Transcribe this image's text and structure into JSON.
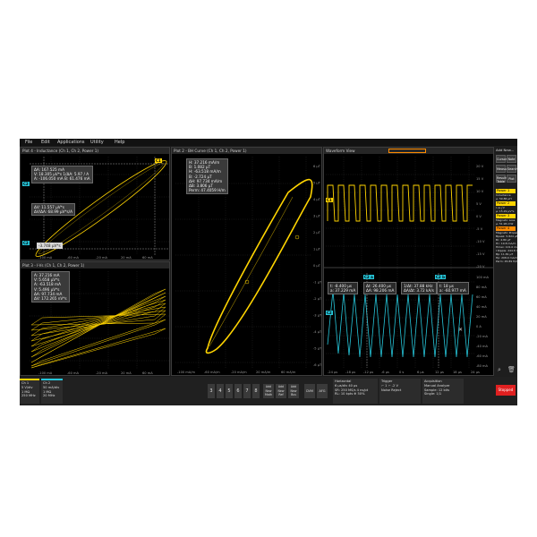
{
  "menu": {
    "items": [
      "File",
      "Edit",
      "Applications",
      "Utility",
      "Help"
    ]
  },
  "plot4": {
    "title": "Plot 4 - Inductance (Ch 1, Ch 2, Power 1)",
    "readout_a": [
      "ΔA: 167.525 mA",
      "V: 18.305 µV*s  1/ΔA: 5.97 / A",
      "A: -106.050 mA   B: 61.476 mA"
    ],
    "readout_b": [
      "ΔV: 11.557 µV*s",
      "ΔV/ΔA: 68.99 µV*s/A"
    ],
    "cursor_value": "-3.748 µV*s",
    "xticks": [
      "-100 mA",
      "-60 mA",
      "-20 mA",
      "20 mA",
      "60 mA",
      "100 mA"
    ]
  },
  "plot3": {
    "title": "Plot 3 - I-Vs (Ch 1, Ch 2, Power 1)",
    "readout": [
      "A: 37.216 mA",
      "V: 5.658 µV*s",
      "A: -63.518 mA",
      "V: 5.496 µV*s",
      "ΔA: 97.734 mA",
      "ΔV: 172.265 nV*s"
    ],
    "xticks": [
      "-100 mA",
      "-60 mA",
      "-20 mA",
      "20 mA",
      "60 mA",
      "100 mA"
    ]
  },
  "plot2": {
    "title": "Plot 2 - BH Curve (Ch 1, Ch 2, Power 1)",
    "readout": [
      "H: 37.216 mA/m",
      "B: 1.082 µT",
      "H: -63.518 mA/m",
      "B: -2.724 µT",
      "ΔH: 97.734 mA/m",
      "ΔB: 3.806 µT",
      "Perm: 47.4059 H/m"
    ],
    "yticks": [
      "6 µT",
      "5 µT",
      "4 µT",
      "3 µT",
      "2 µT",
      "1 µT",
      "0 µT",
      "-1 µT",
      "-2 µT",
      "-3 µT",
      "-4 µT",
      "-5 µT",
      "-6 µT"
    ],
    "xticks": [
      "-100 mA/m",
      "-60 mA/m",
      "-20 mA/m",
      "20 mA/m",
      "60 mA/m",
      "100 mA/m"
    ]
  },
  "waveform": {
    "title": "Waveform View",
    "top_yticks": [
      "20 V",
      "15 V",
      "10 V",
      "5 V",
      "0 V",
      "-5 V",
      "-10 V",
      "-15 V",
      "-20 V"
    ],
    "bottom_yticks": [
      "100 mA",
      "80 mA",
      "60 mA",
      "40 mA",
      "20 mA",
      "0 A",
      "-20 mA",
      "-40 mA",
      "-60 mA",
      "-80 mA"
    ],
    "readout_left": [
      "t: -8.400 µs",
      "a: 37.229 mA"
    ],
    "readout_mid": [
      "Δt: 26.400 µs",
      "ΔA: 98.206 mA"
    ],
    "readout_mid2": [
      "1/Δt: 37.88 kHz",
      "ΔA/Δt: 3.72 kA/s"
    ],
    "readout_right": [
      "t: 18 µs",
      "a: -60.977 mA"
    ],
    "xticks": [
      "-24 µs",
      "-18 µs",
      "-12 µs",
      "-6 µs",
      "0 s",
      "6 µs",
      "12 µs",
      "18 µs",
      "24 µs"
    ]
  },
  "rightpanel": {
    "add_new": "Add New...",
    "buttons": [
      "Cursors",
      "Note",
      "Measure",
      "Search",
      "Results Table",
      "Plot"
    ],
    "power1": {
      "label": "Power 1",
      "lines": [
        "Inductance",
        "µ: 59.86 µH"
      ]
    },
    "power2": {
      "label": "Power 2",
      "lines": [
        "I vs ∫V",
        "µ: 15.29 µV*s"
      ]
    },
    "power3": {
      "label": "Power 3",
      "lines": [
        "Magnetic Loss",
        "µ: 51.96 mW"
      ]
    },
    "power4": {
      "label": "Power 4",
      "lines": [
        "Magnetic Property",
        "Bpeak: 5.824 µT",
        "Br: 4.80 µT",
        "Hc: 19.8 mA/m",
        "Hmax: 101.0 mA/m",
        "I Ripple: 244.8 mA",
        "Bp: 11.81 µT",
        "Hp: 208.0 mA/m",
        "Perm: 45.89 H/m"
      ]
    }
  },
  "bottom": {
    "ch1": [
      "Ch 1",
      "5 V/div",
      "1 MΩ",
      "250 MHz"
    ],
    "ch2": [
      "Ch 2",
      "50 mA/div",
      "1 MΩ",
      "20 MHz"
    ],
    "ch_buttons": [
      "3",
      "4",
      "5",
      "6",
      "7",
      "8"
    ],
    "add_buttons": [
      "Add New Math",
      "Add New Ref",
      "Add New Bus"
    ],
    "dvm": "DVM",
    "afg": "AFG",
    "horizontal": [
      "Horizontal",
      "6 µs/div   40 µs",
      "SR: 250 MS/s  4 ns/pt",
      "RL: 10 kpts  ⊕ 50%"
    ],
    "trigger": [
      "Trigger",
      "⌐ 1  ⌐  -2 V",
      "Noise Reject"
    ],
    "acquisition": [
      "Acquisition",
      "Manual   Analyze",
      "Sample: 12 bits",
      "Single: 1/1"
    ],
    "stopped": "Stopped"
  },
  "colors": {
    "ch1": "#ffd400",
    "ch2": "#26c6da",
    "power1": "#ffd400",
    "power4": "#ff8c00",
    "stopped": "#e02020"
  }
}
